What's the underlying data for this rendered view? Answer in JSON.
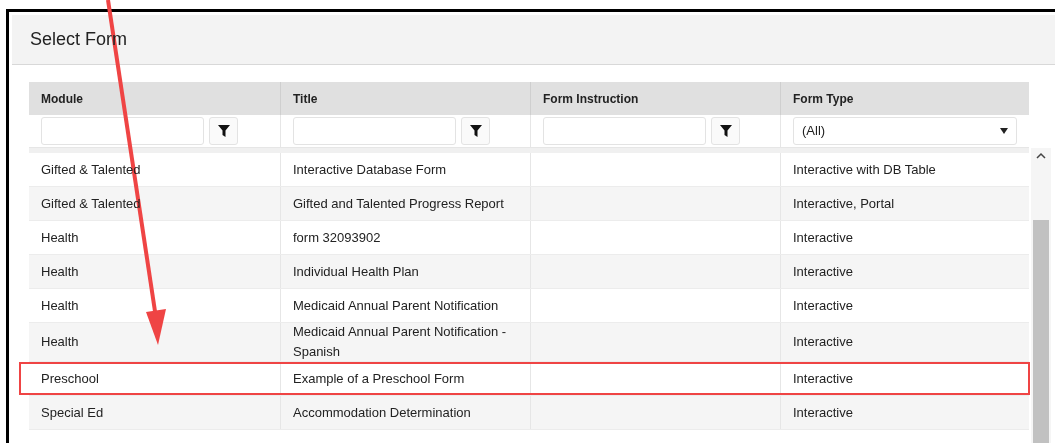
{
  "dialog": {
    "title": "Select Form"
  },
  "table": {
    "columns": [
      {
        "label": "Module",
        "kind": "text"
      },
      {
        "label": "Title",
        "kind": "text"
      },
      {
        "label": "Form Instruction",
        "kind": "text"
      },
      {
        "label": "Form Type",
        "kind": "select",
        "value": "(All)"
      }
    ],
    "rows": [
      {
        "cells": [
          "Gifted & Talented",
          "Interactive Database Form",
          "",
          "Interactive with DB Table"
        ],
        "highlighted": false
      },
      {
        "cells": [
          "Gifted & Talented",
          "Gifted and Talented Progress Report",
          "",
          "Interactive, Portal"
        ],
        "highlighted": false
      },
      {
        "cells": [
          "Health",
          "form 32093902",
          "",
          "Interactive"
        ],
        "highlighted": false
      },
      {
        "cells": [
          "Health",
          "Individual Health Plan",
          "",
          "Interactive"
        ],
        "highlighted": false
      },
      {
        "cells": [
          "Health",
          "Medicaid Annual Parent Notification",
          "",
          "Interactive"
        ],
        "highlighted": false
      },
      {
        "cells": [
          "Health",
          "Medicaid Annual Parent Notification - Spanish",
          "",
          "Interactive"
        ],
        "highlighted": false
      },
      {
        "cells": [
          "Preschool",
          "Example of a Preschool Form",
          "",
          "Interactive"
        ],
        "highlighted": true
      },
      {
        "cells": [
          "Special Ed",
          "Accommodation Determination",
          "",
          "Interactive"
        ],
        "highlighted": false
      }
    ]
  }
}
